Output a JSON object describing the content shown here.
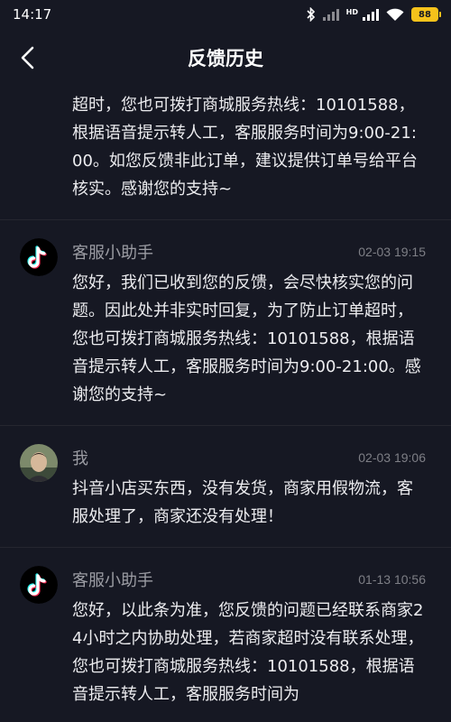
{
  "status_bar": {
    "time": "14:17",
    "network": "HD",
    "battery": "88"
  },
  "nav": {
    "title": "反馈历史",
    "back_icon": "chevron-left-icon"
  },
  "messages": [
    {
      "sender": "",
      "time": "",
      "text": "时回复，如果后续您有售后问题，为了防止订单超时，您也可拨打商城服务热线：10101588，根据语音提示转人工，客服服务时间为9:00-21:00。如您反馈非此订单，建议提供订单号给平台核实。感谢您的支持~"
    },
    {
      "sender": "客服小助手",
      "time": "02-03 19:15",
      "avatar": "tiktok-logo-avatar",
      "text": "您好，我们已收到您的反馈，会尽快核实您的问题。因此处并非实时回复，为了防止订单超时，您也可拨打商城服务热线：10101588，根据语音提示转人工，客服服务时间为9:00-21:00。感谢您的支持~"
    },
    {
      "sender": "我",
      "time": "02-03 19:06",
      "avatar": "user-photo-avatar",
      "text": "抖音小店买东西，没有发货，商家用假物流，客服处理了，商家还没有处理！"
    },
    {
      "sender": "客服小助手",
      "time": "01-13 10:56",
      "avatar": "tiktok-logo-avatar",
      "text": "您好，以此条为准，您反馈的问题已经联系商家24小时之内协助处理，若商家超时没有联系处理，您也可拨打商城服务热线：10101588，根据语音提示转人工，客服服务时间为"
    }
  ]
}
